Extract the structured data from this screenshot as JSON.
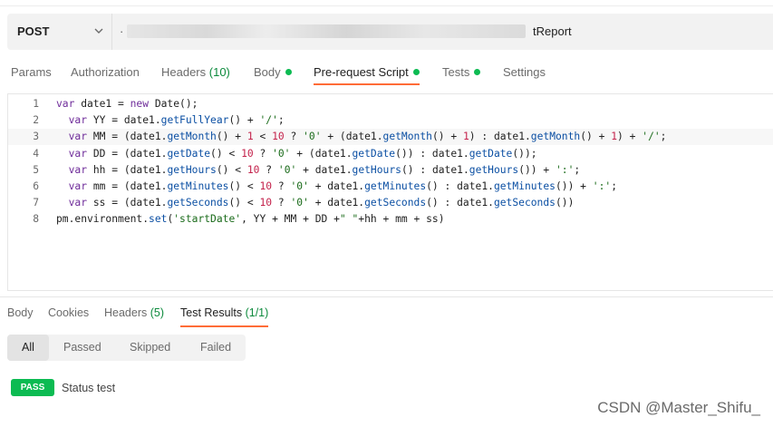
{
  "request": {
    "method": "POST",
    "url_prefix": "·",
    "url_suffix": "tReport"
  },
  "request_tabs": [
    {
      "label": "Params"
    },
    {
      "label": "Authorization"
    },
    {
      "label": "Headers",
      "count": "(10)"
    },
    {
      "label": "Body"
    },
    {
      "label": "Pre-request Script"
    },
    {
      "label": "Tests"
    },
    {
      "label": "Settings"
    }
  ],
  "editor": {
    "active_line": 3,
    "lines": [
      {
        "n": "1",
        "text": "var date1 = new Date();"
      },
      {
        "n": "2",
        "text": "  var YY = date1.getFullYear() + '/';"
      },
      {
        "n": "3",
        "text": "  var MM = (date1.getMonth() + 1 < 10 ? '0' + (date1.getMonth() + 1) : date1.getMonth() + 1) + '/';"
      },
      {
        "n": "4",
        "text": "  var DD = (date1.getDate() < 10 ? '0' + (date1.getDate()) : date1.getDate());"
      },
      {
        "n": "5",
        "text": "  var hh = (date1.getHours() < 10 ? '0' + date1.getHours() : date1.getHours()) + ':';"
      },
      {
        "n": "6",
        "text": "  var mm = (date1.getMinutes() < 10 ? '0' + date1.getMinutes() : date1.getMinutes()) + ':';"
      },
      {
        "n": "7",
        "text": "  var ss = (date1.getSeconds() < 10 ? '0' + date1.getSeconds() : date1.getSeconds())"
      },
      {
        "n": "8",
        "text": "pm.environment.set('startDate', YY + MM + DD +\" \"+hh + mm + ss)"
      }
    ]
  },
  "response_tabs": [
    {
      "label": "Body"
    },
    {
      "label": "Cookies"
    },
    {
      "label": "Headers",
      "count": "(5)"
    },
    {
      "label": "Test Results",
      "count": "(1/1)"
    }
  ],
  "filters": [
    "All",
    "Passed",
    "Skipped",
    "Failed"
  ],
  "result": {
    "badge": "PASS",
    "name": "Status test"
  },
  "watermark": "CSDN @Master_Shifu_",
  "colors": {
    "accent": "#ff6c37",
    "pass": "#0cbb52"
  }
}
